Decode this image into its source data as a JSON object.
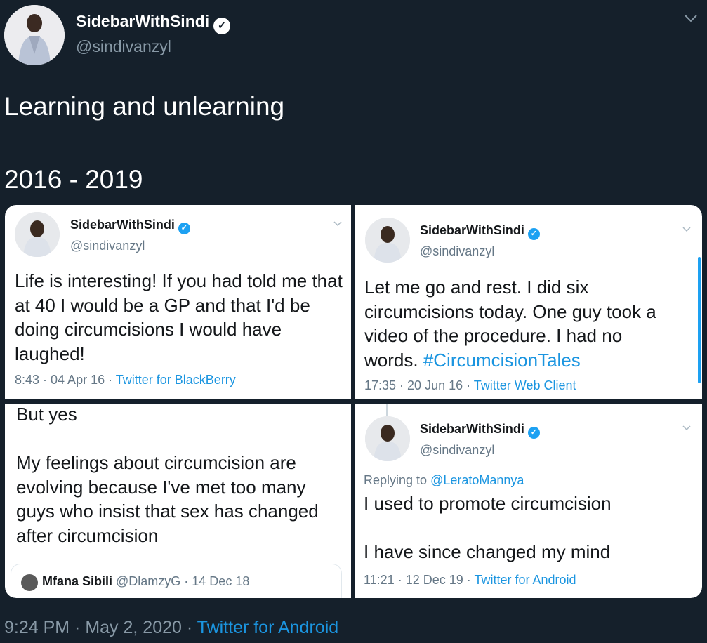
{
  "header": {
    "display_name": "SidebarWithSindi",
    "handle": "@sindivanzyl",
    "avatar_icon": "profile-photo",
    "verified_icon": "verified-badge-icon",
    "menu_icon": "chevron-down-icon"
  },
  "tweet": {
    "text": "Learning and unlearning\n\n2016 - 2019"
  },
  "collage": {
    "panel1": {
      "display_name": "SidebarWithSindi",
      "handle": "@sindivanzyl",
      "body": "Life is interesting! If you had told me that at 40 I would be a GP and that I'd be doing circumcisions I would have laughed!",
      "time": "8:43 · 04 Apr 16 · ",
      "source": "Twitter for BlackBerry"
    },
    "panel2": {
      "display_name": "SidebarWithSindi",
      "handle": "@sindivanzyl",
      "body": "Let me go and rest. I did six circumcisions today. One guy took a video of the procedure. I had no words. ",
      "hashtag": "#CircumcisionTales",
      "time": "17:35 · 20 Jun 16 · ",
      "source": "Twitter Web Client"
    },
    "panel3": {
      "body": "But yes\n\nMy feelings about circumcision are evolving because I've met too many guys who insist that sex has changed after circumcision",
      "quote_name": "Mfana Sibili",
      "quote_meta": " @DlamzyG · 14 Dec 18"
    },
    "panel4": {
      "display_name": "SidebarWithSindi",
      "handle": "@sindivanzyl",
      "replying_prefix": "Replying to ",
      "replying_to": "@LeratoMannya",
      "body": "I used to promote circumcision\n\nI have since changed my mind",
      "time": "11:21 · 12 Dec 19 · ",
      "source": "Twitter for Android"
    }
  },
  "footer": {
    "timestamp": "9:24 PM · May 2, 2020 · ",
    "source": "Twitter for Android"
  },
  "colors": {
    "background": "#15202b",
    "secondary_text": "#8899a6",
    "link": "#1b95e0",
    "verified": "#1da1f2"
  }
}
